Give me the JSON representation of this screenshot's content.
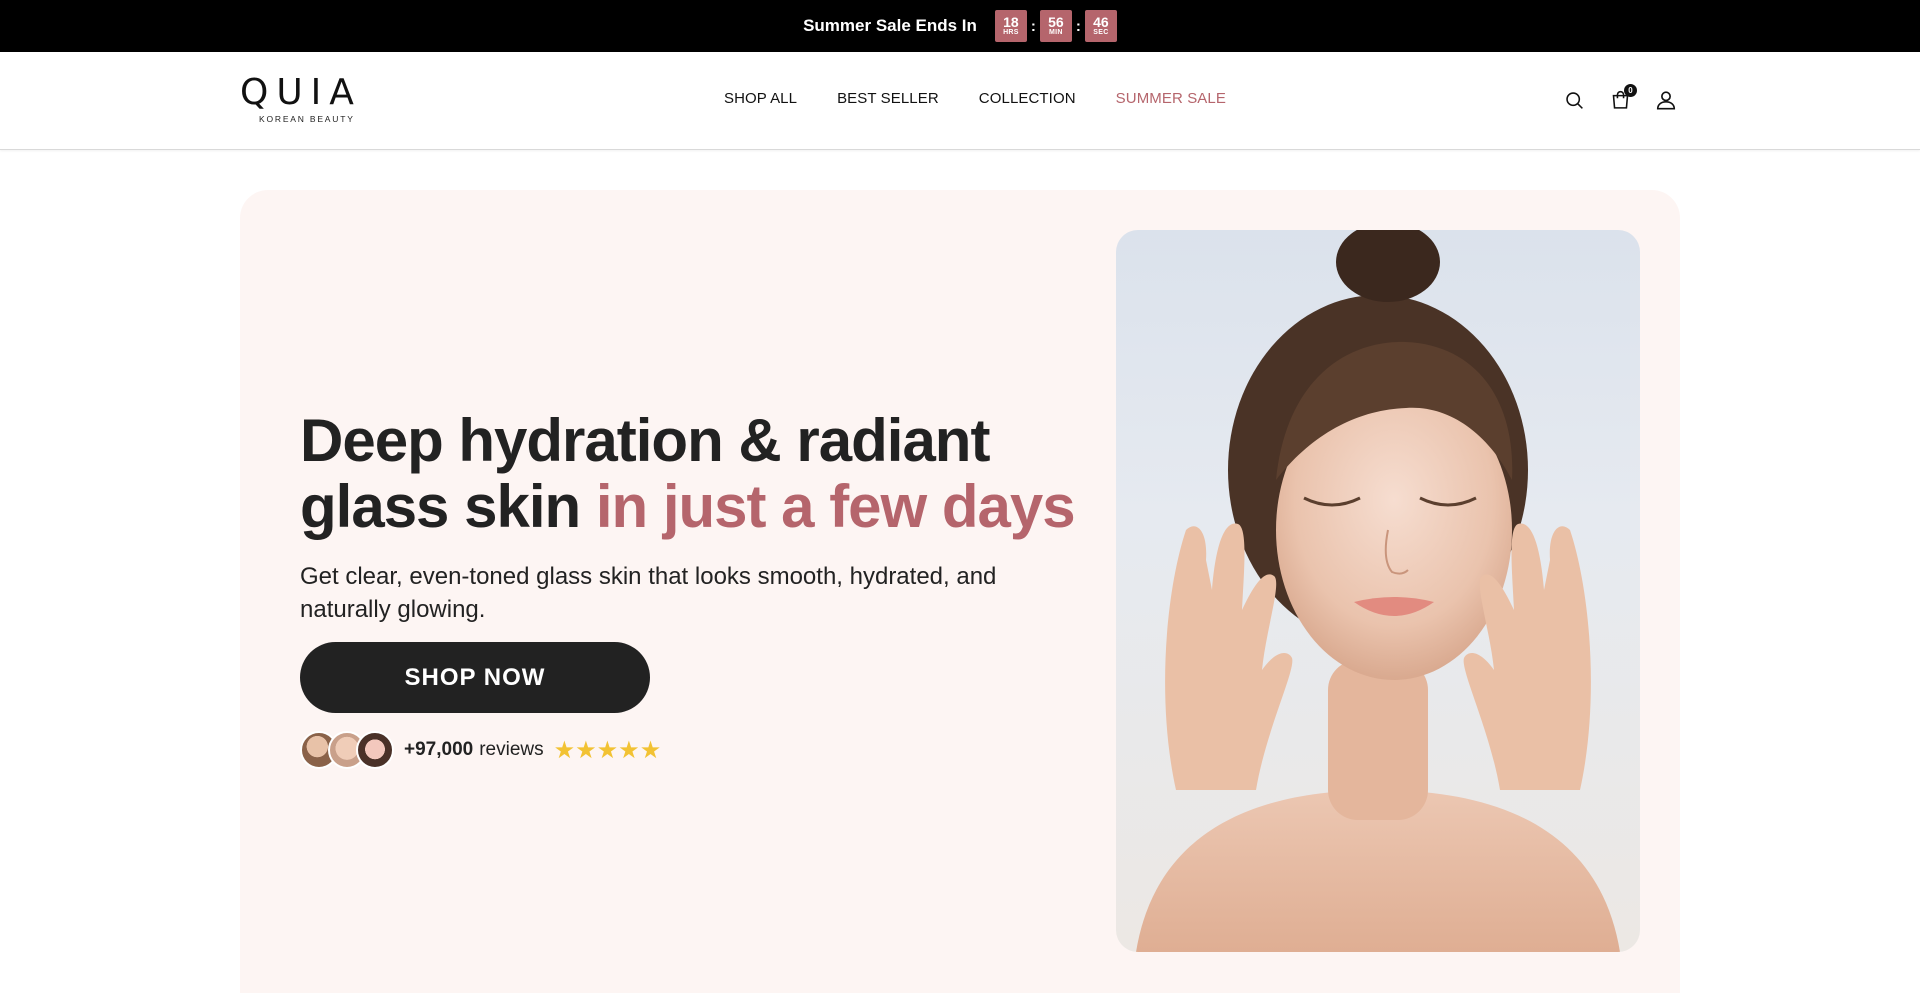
{
  "announcement": {
    "text": "Summer Sale Ends In",
    "timer": [
      {
        "value": "18",
        "unit": "HRS"
      },
      {
        "value": "56",
        "unit": "MIN"
      },
      {
        "value": "46",
        "unit": "SEC"
      }
    ],
    "separator": ":",
    "accent_color": "#b5656c"
  },
  "header": {
    "logo_word": "QUIA",
    "logo_sub": "KOREAN BEAUTY",
    "nav": [
      {
        "label": "SHOP ALL"
      },
      {
        "label": "BEST SELLER"
      },
      {
        "label": "COLLECTION"
      },
      {
        "label": "SUMMER SALE"
      }
    ],
    "cart_count": "0",
    "icons": [
      "search-icon",
      "cart-icon",
      "account-icon"
    ]
  },
  "hero": {
    "title_line1": "Deep hydration & radiant",
    "title_line2": "glass skin",
    "title_accent": "in just a few days",
    "subtitle": "Get clear, even-toned glass skin that looks smooth, hydrated, and naturally glowing.",
    "cta_label": "SHOP NOW",
    "reviews_count": "+97,000",
    "reviews_label": "reviews",
    "stars": "★★★★★",
    "rating": 5,
    "background_color": "#fdf5f3",
    "accent_color": "#b5656c"
  }
}
